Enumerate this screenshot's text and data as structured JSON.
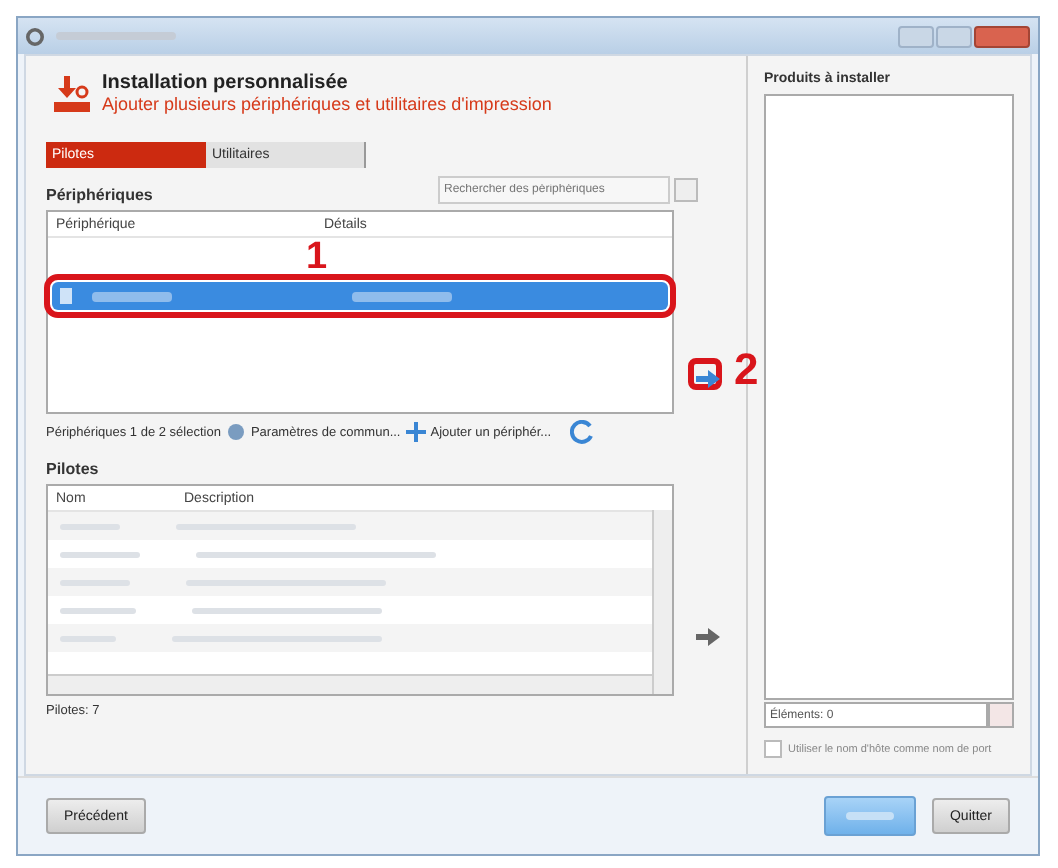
{
  "header": {
    "title": "Installation personnalisée",
    "subtitle": "Ajouter plusieurs périphériques et utilitaires d'impression"
  },
  "tabs": [
    {
      "label": "Pilotes",
      "selected": true
    },
    {
      "label": "Utilitaires",
      "selected": false
    }
  ],
  "devices": {
    "label": "Périphériques",
    "search": {
      "placeholder": "Rechercher des périphériques"
    },
    "columns": [
      "Périphérique",
      "Détails"
    ],
    "rows": [
      {
        "selected": true
      }
    ],
    "status": "Périphériques 1 de 2 sélection",
    "actions": [
      "Paramètres de commun...",
      "Ajouter un périphér..."
    ]
  },
  "drivers": {
    "label": "Pilotes",
    "columns": [
      "Nom",
      "Description"
    ],
    "count": "Pilotes: 7"
  },
  "products": {
    "label": "Produits à installer",
    "items_count": "Éléments: 0",
    "hostname_option": {
      "label": "Utiliser le nom d'hôte comme nom de port",
      "checked": false
    }
  },
  "buttons": [
    {
      "label": "Précédent"
    },
    {
      "label": "Quitter"
    }
  ],
  "annotations": [
    {
      "label": "1"
    },
    {
      "label": "2"
    }
  ]
}
